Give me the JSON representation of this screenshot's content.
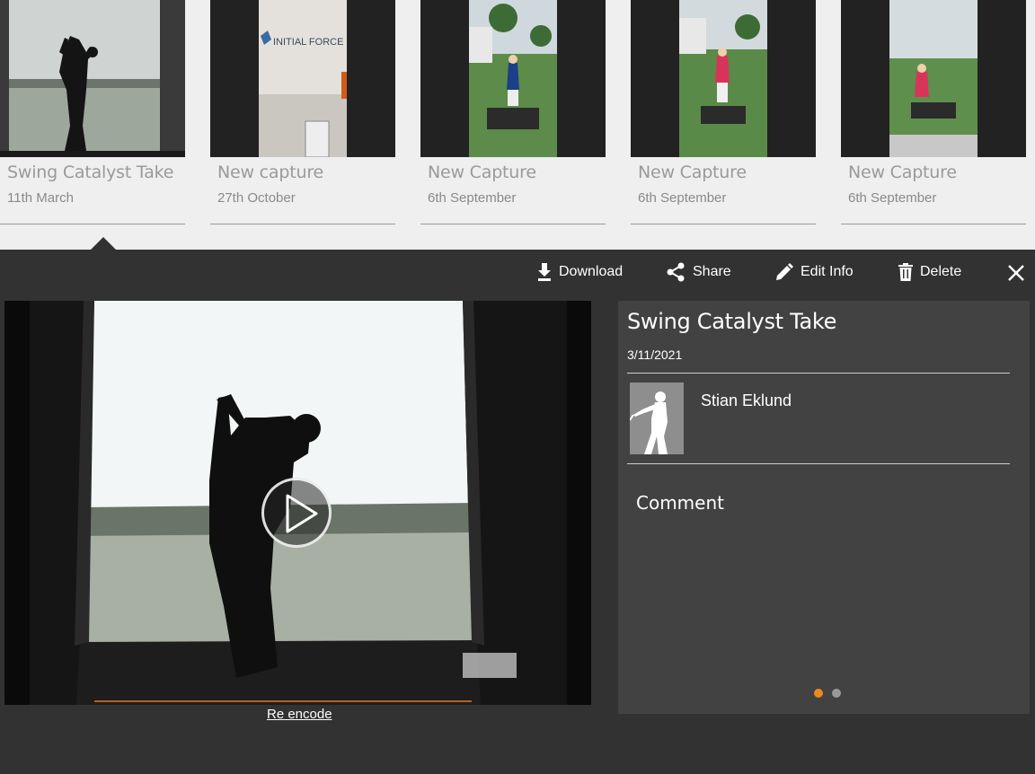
{
  "gallery": {
    "items": [
      {
        "title": "Swing Catalyst Take",
        "date": "11th March"
      },
      {
        "title": "New capture",
        "date": "27th October"
      },
      {
        "title": "New Capture",
        "date": "6th September"
      },
      {
        "title": "New Capture",
        "date": "6th September"
      },
      {
        "title": "New Capture",
        "date": "6th September"
      }
    ],
    "selected_index": 0,
    "thumb_text": {
      "sign": "INITIAL FORCE"
    }
  },
  "toolbar": {
    "download_label": "Download",
    "share_label": "Share",
    "edit_label": "Edit Info",
    "delete_label": "Delete"
  },
  "detail": {
    "title": "Swing Catalyst Take",
    "date": "3/11/2021",
    "player_name": "Stian Eklund",
    "comment_label": "Comment",
    "re_encode_label": "Re encode",
    "pager": {
      "count": 2,
      "active": 1
    }
  },
  "colors": {
    "panel_bg": "#323232",
    "info_bg": "#424242",
    "accent": "#e98b1c",
    "gallery_bg": "#efefef"
  },
  "icons": [
    "download-icon",
    "share-icon",
    "pencil-icon",
    "trash-icon",
    "close-icon",
    "play-icon",
    "golfer-silhouette-icon"
  ]
}
